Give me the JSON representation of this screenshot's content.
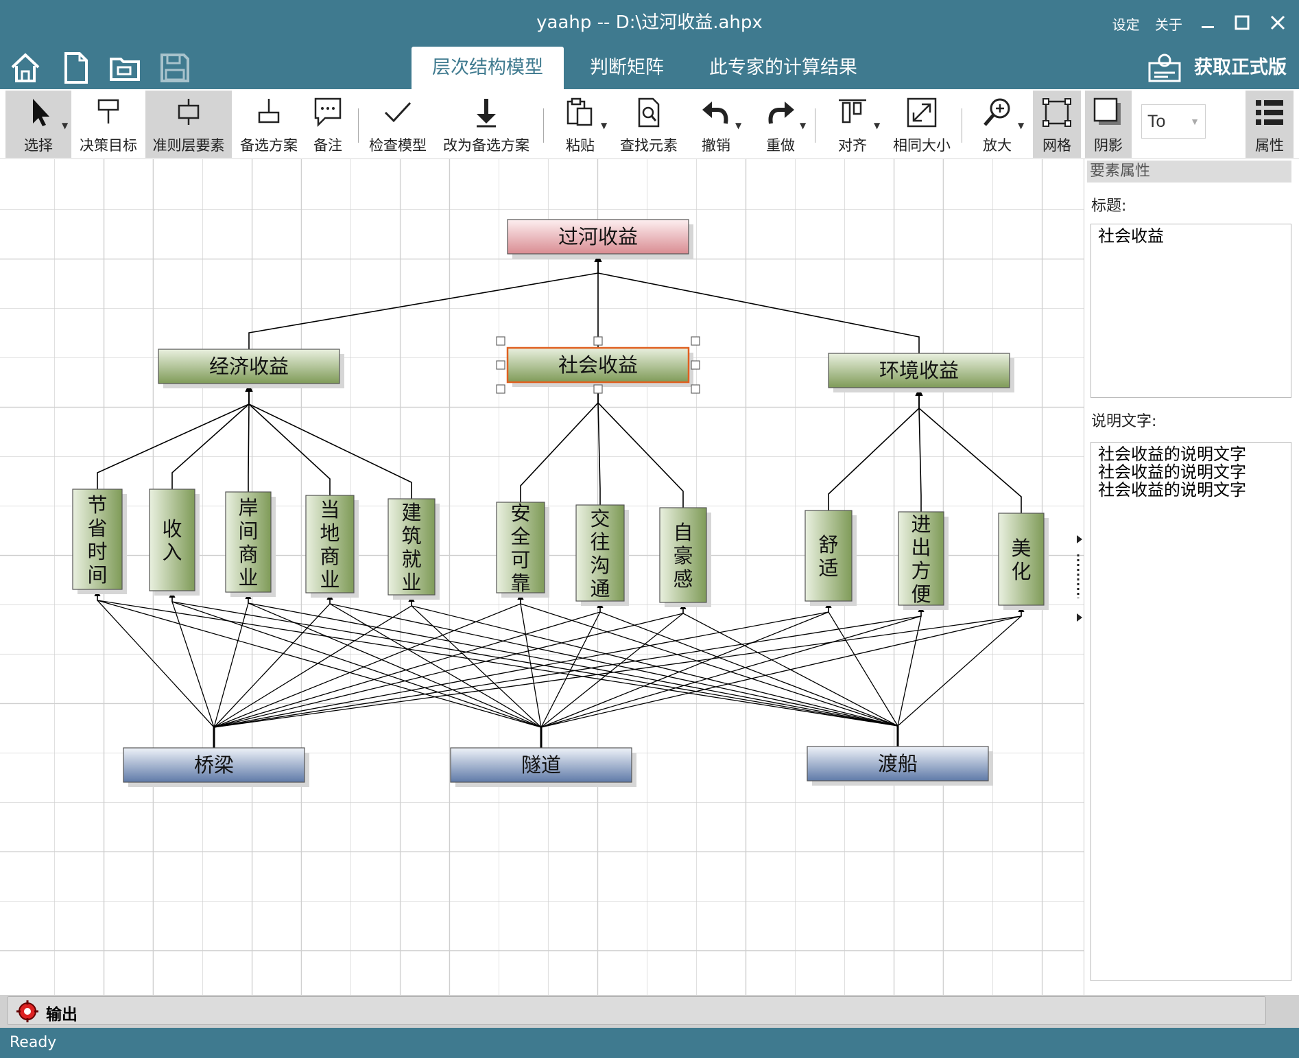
{
  "window": {
    "title": "yaahp -- D:\\过河收益.ahpx",
    "links": [
      "设定",
      "关于"
    ]
  },
  "quick_access": [
    "home-icon",
    "new-file-icon",
    "open-folder-icon",
    "save-icon"
  ],
  "tabs": [
    {
      "label": "层次结构模型",
      "active": true
    },
    {
      "label": "判断矩阵",
      "active": false
    },
    {
      "label": "此专家的计算结果",
      "active": false
    }
  ],
  "buy_button": "获取正式版",
  "toolbar": {
    "items": [
      {
        "label": "选择",
        "icon": "pointer-icon",
        "pressed": true
      },
      {
        "label": "决策目标",
        "icon": "goal-icon",
        "pressed": false
      },
      {
        "label": "准则层要素",
        "icon": "criterion-icon",
        "pressed": true
      },
      {
        "label": "备选方案",
        "icon": "alternative-icon",
        "pressed": false
      },
      {
        "label": "备注",
        "icon": "note-icon",
        "pressed": false
      },
      {
        "label": "检查模型",
        "icon": "check-icon",
        "pressed": false
      },
      {
        "label": "改为备选方案",
        "icon": "convert-icon",
        "pressed": false
      },
      {
        "label": "粘贴",
        "icon": "paste-icon",
        "pressed": false
      },
      {
        "label": "查找元素",
        "icon": "find-icon",
        "pressed": false
      },
      {
        "label": "撤销",
        "icon": "undo-icon",
        "pressed": false
      },
      {
        "label": "重做",
        "icon": "redo-icon",
        "pressed": false
      },
      {
        "label": "对齐",
        "icon": "align-icon",
        "pressed": false
      },
      {
        "label": "相同大小",
        "icon": "same-size-icon",
        "pressed": false
      },
      {
        "label": "放大",
        "icon": "zoom-icon",
        "pressed": false
      },
      {
        "label": "网格",
        "icon": "grid-icon",
        "pressed": true
      },
      {
        "label": "阴影",
        "icon": "shadow-icon",
        "pressed": true
      },
      {
        "label": "属性",
        "icon": "properties-icon",
        "pressed": true
      }
    ],
    "font_value": "To"
  },
  "model": {
    "goal": "过河收益",
    "criteria": [
      "经济收益",
      "社会收益",
      "环境收益"
    ],
    "selected_criterion": "社会收益",
    "subcriteria": [
      {
        "label": "节省时间",
        "parent": "经济收益"
      },
      {
        "label": "收入",
        "parent": "经济收益"
      },
      {
        "label": "岸间商业",
        "parent": "经济收益"
      },
      {
        "label": "当地商业",
        "parent": "经济收益"
      },
      {
        "label": "建筑就业",
        "parent": "经济收益"
      },
      {
        "label": "安全可靠",
        "parent": "社会收益"
      },
      {
        "label": "交往沟通",
        "parent": "社会收益"
      },
      {
        "label": "自豪感",
        "parent": "社会收益"
      },
      {
        "label": "舒适",
        "parent": "环境收益"
      },
      {
        "label": "进出方便",
        "parent": "环境收益"
      },
      {
        "label": "美化",
        "parent": "环境收益"
      }
    ],
    "alternatives": [
      "桥梁",
      "隧道",
      "渡船"
    ]
  },
  "properties": {
    "header": "要素属性",
    "title_label": "标题:",
    "title_value": "社会收益",
    "desc_label": "说明文字:",
    "desc_lines": [
      "社会收益的说明文字",
      "社会收益的说明文字",
      "社会收益的说明文字"
    ]
  },
  "output_label": "输出",
  "status": "Ready",
  "colors": {
    "chrome": "#3f7a8f",
    "goal_fill": "#e8a4a8",
    "criterion_fill": "#8fa86a",
    "alternative_fill": "#6e86b0",
    "selection": "#e06020"
  }
}
